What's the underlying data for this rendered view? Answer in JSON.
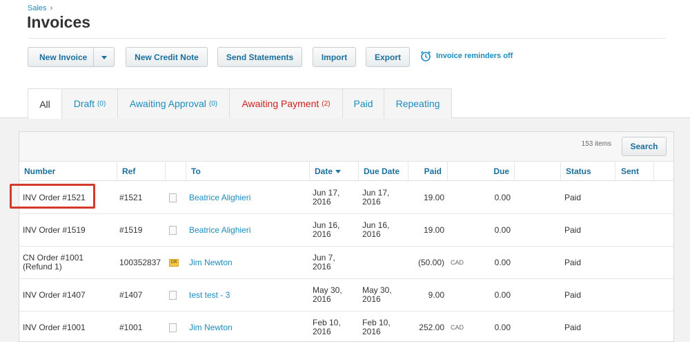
{
  "breadcrumb": {
    "parent": "Sales",
    "sep": "›"
  },
  "page_title": "Invoices",
  "toolbar": {
    "new_invoice": "New Invoice",
    "new_credit_note": "New Credit Note",
    "send_statements": "Send Statements",
    "import": "Import",
    "export": "Export",
    "reminders": "Invoice reminders off"
  },
  "tabs": [
    {
      "label": "All",
      "count": ""
    },
    {
      "label": "Draft",
      "count": "(0)"
    },
    {
      "label": "Awaiting Approval",
      "count": "(0)"
    },
    {
      "label": "Awaiting Payment",
      "count": "(2)"
    },
    {
      "label": "Paid",
      "count": ""
    },
    {
      "label": "Repeating",
      "count": ""
    }
  ],
  "list": {
    "items_count": "153 items",
    "search_label": "Search",
    "columns": {
      "number": "Number",
      "ref": "Ref",
      "to": "To",
      "date": "Date",
      "due_date": "Due Date",
      "paid": "Paid",
      "due": "Due",
      "status": "Status",
      "sent": "Sent"
    },
    "rows": [
      {
        "number": "INV Order #1521",
        "ref": "#1521",
        "icon": "document-icon",
        "to": "Beatrice Alighieri",
        "date": "Jun 17, 2016",
        "due_date": "Jun 17, 2016",
        "paid": "19.00",
        "currency": "",
        "due": "0.00",
        "status": "Paid"
      },
      {
        "number": "INV Order #1519",
        "ref": "#1519",
        "icon": "document-icon",
        "to": "Beatrice Alighieri",
        "date": "Jun 16, 2016",
        "due_date": "Jun 16, 2016",
        "paid": "19.00",
        "currency": "",
        "due": "0.00",
        "status": "Paid"
      },
      {
        "number": "CN Order #1001 (Refund 1)",
        "ref": "100352837",
        "icon": "credit-note-icon",
        "to": "Jim Newton",
        "date": "Jun 7, 2016",
        "due_date": "",
        "paid": "(50.00)",
        "currency": "CAD",
        "due": "0.00",
        "status": "Paid"
      },
      {
        "number": "INV Order #1407",
        "ref": "#1407",
        "icon": "document-icon",
        "to": "test test - 3",
        "date": "May 30, 2016",
        "due_date": "May 30, 2016",
        "paid": "9.00",
        "currency": "",
        "due": "0.00",
        "status": "Paid"
      },
      {
        "number": "INV Order #1001",
        "ref": "#1001",
        "icon": "document-icon",
        "to": "Jim Newton",
        "date": "Feb 10, 2016",
        "due_date": "Feb 10, 2016",
        "paid": "252.00",
        "currency": "CAD",
        "due": "0.00",
        "status": "Paid"
      }
    ]
  },
  "credit_note_badge": "CR",
  "colors": {
    "accent": "#1a8bbd",
    "awaiting_payment": "#cc1f1f",
    "highlight": "#d33a2c"
  }
}
